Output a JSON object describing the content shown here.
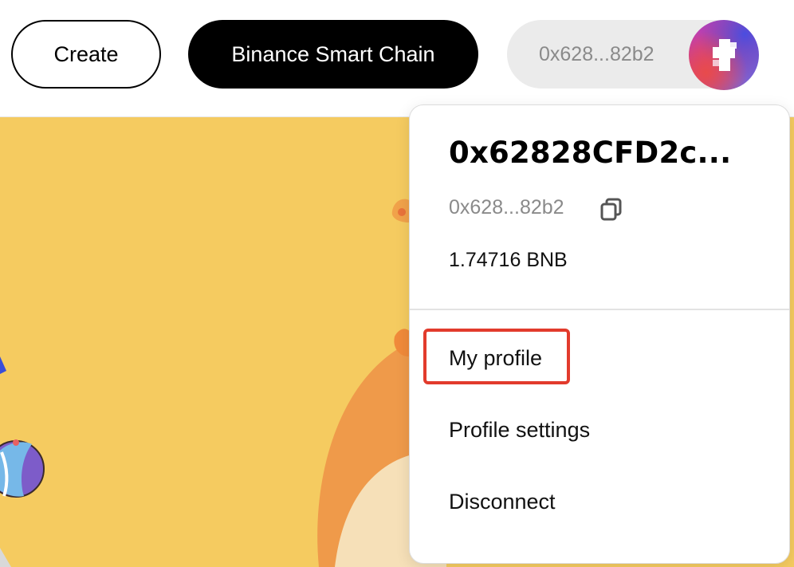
{
  "header": {
    "create_label": "Create",
    "network_label": "Binance Smart Chain",
    "wallet_short": "0x628...82b2"
  },
  "dropdown": {
    "account_name": "0x62828CFD2c...",
    "address_short": "0x628...82b2",
    "balance": "1.74716 BNB",
    "items": [
      {
        "label": "My profile"
      },
      {
        "label": "Profile settings"
      },
      {
        "label": "Disconnect"
      }
    ]
  },
  "colors": {
    "banner_bg": "#f5cb60",
    "highlight": "#e23b2c",
    "network_button_bg": "#000000",
    "wallet_pill_bg": "#ebebeb"
  },
  "icons": {
    "copy": "copy-icon",
    "avatar": "avatar-identicon"
  }
}
